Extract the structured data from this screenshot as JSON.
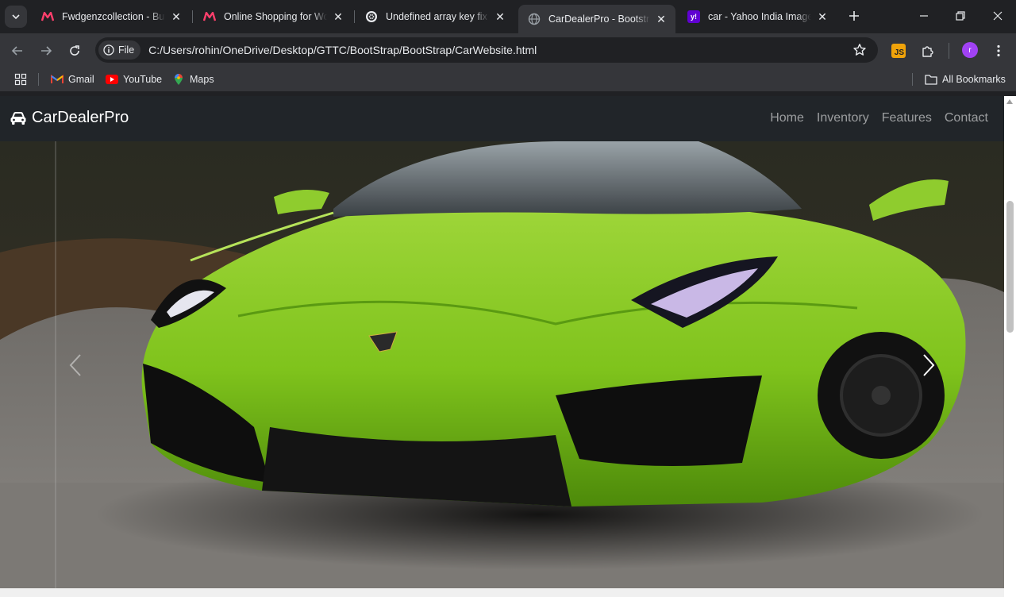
{
  "browser": {
    "tabs": [
      {
        "title": "Fwdgenzcollection - Buy",
        "favicon": "myntra-logo-icon",
        "active": false
      },
      {
        "title": "Online Shopping for Won",
        "favicon": "myntra-logo-icon",
        "active": false
      },
      {
        "title": "Undefined array key fix",
        "favicon": "chatgpt-logo-icon",
        "active": false
      },
      {
        "title": "CarDealerPro - Bootstrap",
        "favicon": "globe-icon",
        "active": true
      },
      {
        "title": "car - Yahoo India Image S",
        "favicon": "yahoo-logo-icon",
        "active": false
      }
    ],
    "address": {
      "scheme_chip": "File",
      "url": "C:/Users/rohin/OneDrive/Desktop/GTTC/BootStrap/BootStrap/CarWebsite.html"
    },
    "extension_badge": "JS",
    "profile_initial": "r",
    "bookmarks": [
      {
        "label": "Gmail",
        "icon": "gmail-icon"
      },
      {
        "label": "YouTube",
        "icon": "youtube-icon"
      },
      {
        "label": "Maps",
        "icon": "maps-icon"
      }
    ],
    "all_bookmarks": "All Bookmarks",
    "colors": {
      "frame": "#202124",
      "toolbar": "#35363a",
      "profile": "#a142f4",
      "js_extension": "#f0a30a"
    }
  },
  "site": {
    "brand": "CarDealerPro",
    "brand_icon": "car-icon",
    "nav": [
      "Home",
      "Inventory",
      "Features",
      "Contact"
    ],
    "colors": {
      "navbar": "#212529",
      "car_body": "#7fc31c"
    }
  }
}
